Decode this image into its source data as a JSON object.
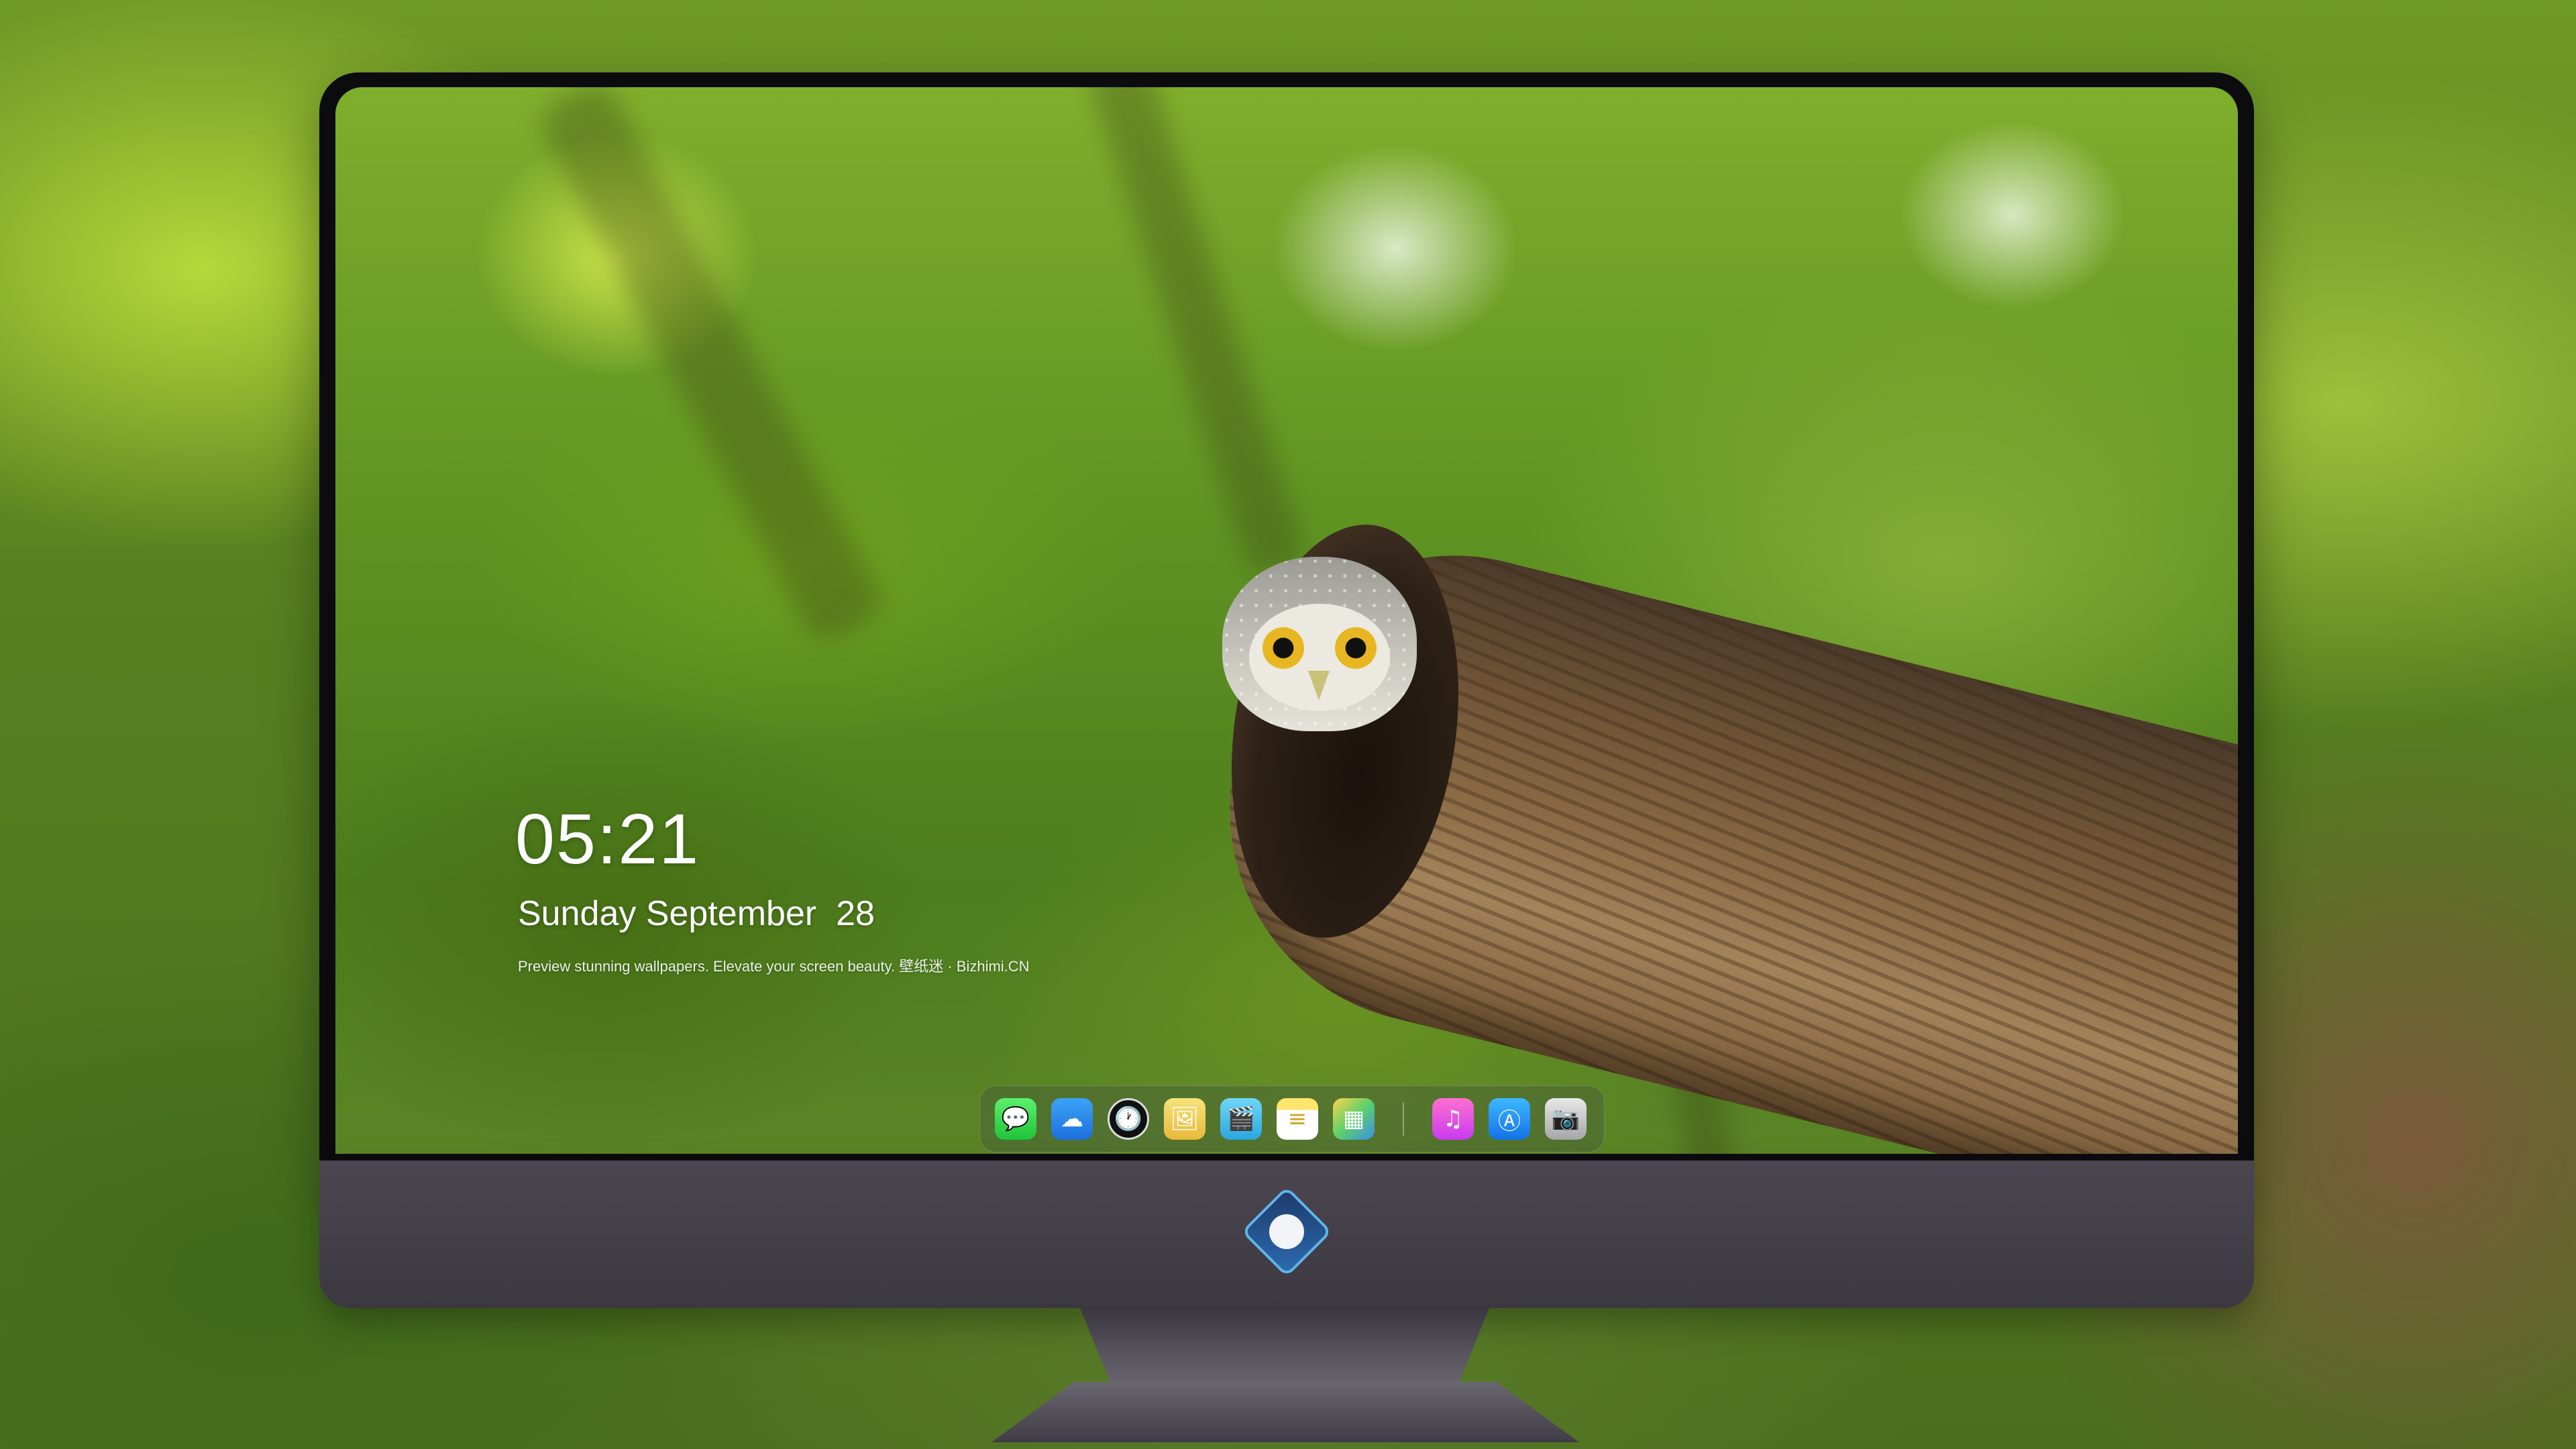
{
  "lockscreen": {
    "time": "05:21",
    "weekday": "Sunday",
    "month": "September",
    "day": "28",
    "tagline": "Preview stunning wallpapers. Elevate your screen beauty. 壁纸迷 · Bizhimi.CN"
  },
  "dock": {
    "apps": [
      {
        "name": "messages-icon",
        "glyph": "💬"
      },
      {
        "name": "weather-icon",
        "glyph": "☁"
      },
      {
        "name": "clock-icon",
        "glyph": "🕐"
      },
      {
        "name": "preview-icon",
        "glyph": "🖼"
      },
      {
        "name": "clips-icon",
        "glyph": "🎬"
      },
      {
        "name": "notes-icon",
        "glyph": "≡"
      },
      {
        "name": "photos-icon",
        "glyph": "▦"
      },
      {
        "name": "music-icon",
        "glyph": "♫"
      },
      {
        "name": "app-store-icon",
        "glyph": "Ⓐ"
      },
      {
        "name": "camera-icon",
        "glyph": "📷"
      }
    ]
  },
  "colors": {
    "text": "#ffffff",
    "bezel": "#0c0c0e",
    "chin": "#4b4650"
  }
}
